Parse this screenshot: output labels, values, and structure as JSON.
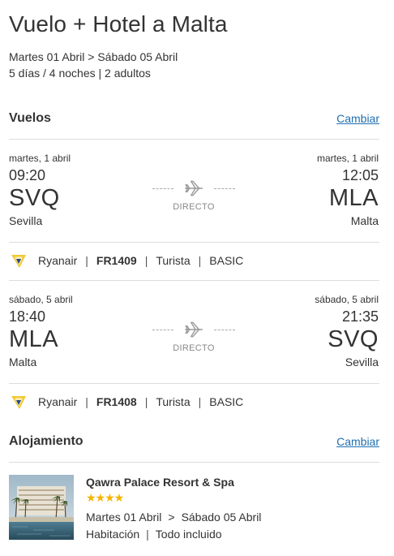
{
  "header": {
    "title": "Vuelo + Hotel a Malta",
    "dates": "Martes 01 Abril > Sábado 05 Abril",
    "summary": "5 días / 4 noches | 2 adultos"
  },
  "flights_section": {
    "title": "Vuelos",
    "change_label": "Cambiar"
  },
  "flights": [
    {
      "dep_date": "martes, 1 abril",
      "dep_time": "09:20",
      "dep_code": "SVQ",
      "dep_city": "Sevilla",
      "arr_date": "martes, 1 abril",
      "arr_time": "12:05",
      "arr_code": "MLA",
      "arr_city": "Malta",
      "stops": "DIRECTO",
      "airline": "Ryanair",
      "flight_number": "FR1409",
      "cabin": "Turista",
      "fare": "BASIC",
      "sep": "|"
    },
    {
      "dep_date": "sábado, 5 abril",
      "dep_time": "18:40",
      "dep_code": "MLA",
      "dep_city": "Malta",
      "arr_date": "sábado, 5 abril",
      "arr_time": "21:35",
      "arr_code": "SVQ",
      "arr_city": "Sevilla",
      "stops": "DIRECTO",
      "airline": "Ryanair",
      "flight_number": "FR1408",
      "cabin": "Turista",
      "fare": "BASIC",
      "sep": "|"
    }
  ],
  "accommodation_section": {
    "title": "Alojamiento",
    "change_label": "Cambiar"
  },
  "hotel": {
    "name": "Qawra Palace Resort & Spa",
    "stars": "★★★★",
    "rating": 4,
    "checkin": "Martes 01 Abril",
    "arrow": ">",
    "checkout": "Sábado 05 Abril",
    "room": "Habitación",
    "sep": "|",
    "board": "Todo incluido"
  },
  "colors": {
    "link": "#1f6fb2",
    "star": "#f5b400",
    "divider": "#dddddd",
    "ryanair_yellow": "#f1c933",
    "ryanair_navy": "#073590"
  },
  "icons": {
    "plane": "plane-icon",
    "airline_logo": "ryanair-logo-icon"
  }
}
